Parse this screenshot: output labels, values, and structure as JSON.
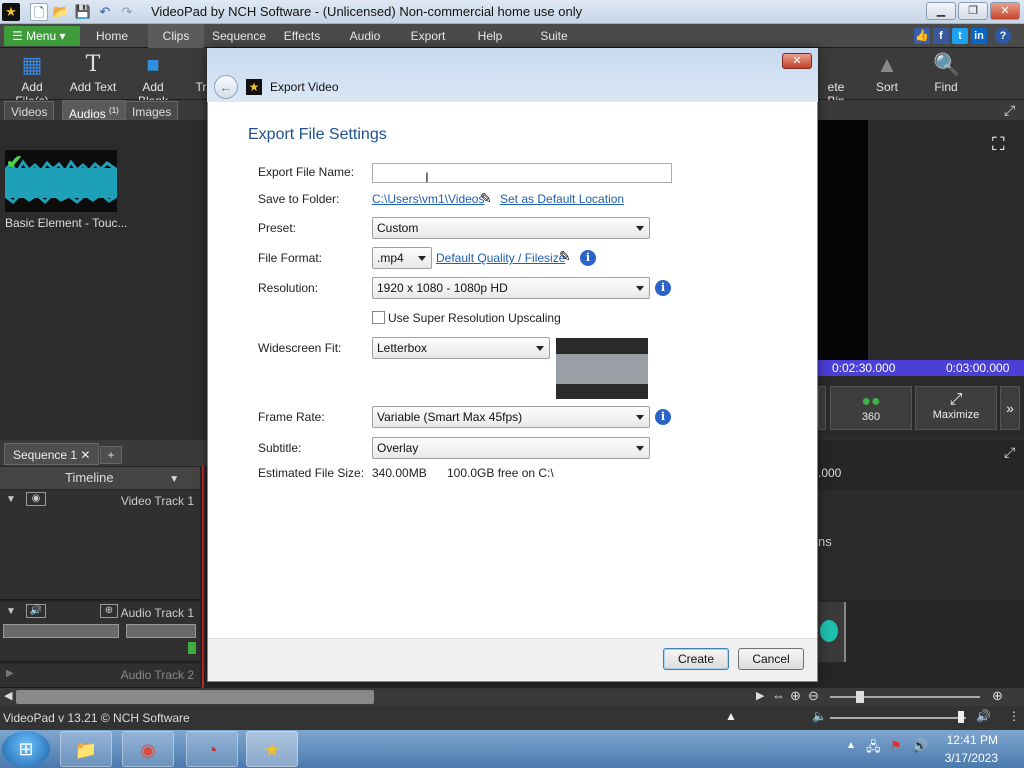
{
  "app": {
    "title": "VideoPad by NCH Software - (Unlicensed) Non-commercial home use only",
    "status": "VideoPad v 13.21 © NCH Software"
  },
  "menubar": {
    "menu_label": "Menu",
    "tabs": [
      "Home",
      "Clips",
      "Sequence",
      "Effects",
      "Audio",
      "Export",
      "Help",
      "Suite"
    ]
  },
  "toolbar": {
    "add_files": "Add File(s)",
    "add_text": "Add Text",
    "add_blank": "Add Blank",
    "tr": "Tr",
    "delete_bin": "ete Bin",
    "sort": "Sort",
    "find": "Find"
  },
  "bins": {
    "tabs": [
      "Videos",
      "Audios",
      "Images"
    ],
    "audios_count": "(1)",
    "clip_label": "Basic Element - Touc..."
  },
  "preview": {
    "time1": "0:02:30.000",
    "time2": "0:03:00.000",
    "btn_360": "360",
    "btn_maximize": "Maximize"
  },
  "timeline": {
    "sequence_tab": "Sequence 1",
    "head": "Timeline",
    "video_track": "Video Track 1",
    "audio_track1": "Audio Track 1",
    "audio_track2": "Audio Track 2",
    "ruler_right": ".000",
    "partial_text": "ns"
  },
  "dialog": {
    "title": "Export Video",
    "heading": "Export File Settings",
    "labels": {
      "file_name": "Export File Name:",
      "save_folder": "Save to Folder:",
      "preset": "Preset:",
      "file_format": "File Format:",
      "resolution": "Resolution:",
      "widescreen": "Widescreen Fit:",
      "frame_rate": "Frame Rate:",
      "subtitle": "Subtitle:",
      "est_size": "Estimated File Size:"
    },
    "file_name_value": "",
    "folder_path": "C:\\Users\\vm1\\Videos",
    "default_location": "Set as Default Location",
    "preset_value": "Custom",
    "format_value": ".mp4",
    "quality_link": "Default Quality / Filesize",
    "resolution_value": "1920 x 1080 - 1080p HD",
    "super_res_label": "Use Super Resolution Upscaling",
    "super_res_checked": false,
    "widescreen_value": "Letterbox",
    "frame_rate_value": "Variable (Smart Max 45fps)",
    "subtitle_value": "Overlay",
    "est_size_value": "340.00MB",
    "free_space": "100.0GB free on C:\\",
    "create_label": "Create",
    "cancel_label": "Cancel"
  },
  "taskbar": {
    "time": "12:41 PM",
    "date": "3/17/2023"
  },
  "colors": {
    "menu_green": "#3e9c3a",
    "link_blue": "#1f5fb2",
    "heading_blue": "#1e4f8f",
    "ruler_purple": "#4a3fd6",
    "playhead_red": "#c2262b"
  }
}
